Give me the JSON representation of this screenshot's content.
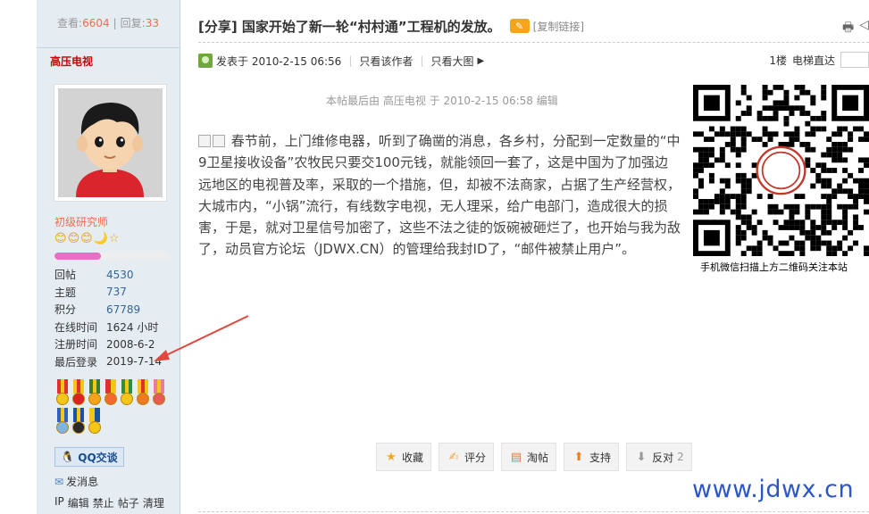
{
  "sidebar": {
    "views_label": "查看:",
    "views_count": "6604",
    "replies_label": "回复:",
    "replies_count": "33",
    "separator": "|",
    "username": "高压电视",
    "rank_title": "初级研究师",
    "rank_icons": [
      "😊",
      "😊",
      "😊",
      "🌙",
      "☆"
    ],
    "rank_progress": 0.4,
    "profile": [
      {
        "key": "回帖",
        "value": "4530"
      },
      {
        "key": "主题",
        "value": "737"
      },
      {
        "key": "积分",
        "value": "67789"
      },
      {
        "key": "在线时间",
        "value": "1624 小时"
      },
      {
        "key": "注册时间",
        "value": "2008-6-2"
      },
      {
        "key": "最后登录",
        "value": "2019-7-14"
      }
    ],
    "qq_label": "QQ交谈",
    "message_label": "发消息",
    "admin_links": [
      "IP",
      "编辑",
      "禁止",
      "帖子",
      "清理"
    ]
  },
  "post": {
    "title": "[分享] 国家开始了新一轮“村村通”工程机的发放。",
    "copy_link": "[复制链接]",
    "posted_label": "发表于 2010-2-15 06:56",
    "only_author": "只看该作者",
    "only_big_image": "只看大图",
    "floor": "1楼",
    "elevator_label": "电梯直达",
    "edit_note": "本帖最后由 高压电视 于 2010-2-15 06:58 编辑",
    "body": "春节前，上门维修电器，听到了确凿的消息，各乡村，分配到一定数量的“中9卫星接收设备”农牧民只要交100元钱，就能领回一套了，这是中国为了加强边远地区的电视普及率，采取的一个措施，但，却被不法商家，占据了生产经营权，大城市内，“小锅”流行，有线数字电视，无人理采，给广电部门，造成很大的损害，于是，就对卫星信号加密了，这些不法之徒的饭碗被砸烂了，也开始与我为敌了，动员官方论坛（JDWX.CN）的管理给我封ID了，“邮件被禁止用户”。",
    "qr_caption": "手机微信扫描上方二维码关注本站"
  },
  "actions": [
    {
      "name": "collect",
      "label": "收藏",
      "icon": "star-icon",
      "color": "#f5a623"
    },
    {
      "name": "rate",
      "label": "评分",
      "icon": "thumb-icon",
      "color": "#e8a84c"
    },
    {
      "name": "taotie",
      "label": "淘帖",
      "icon": "box-icon",
      "color": "#e07b39"
    },
    {
      "name": "support",
      "label": "支持",
      "icon": "up-arrow-icon",
      "color": "#f07c1e"
    },
    {
      "name": "oppose",
      "label": "反对",
      "icon": "down-arrow-icon",
      "color": "#999999",
      "count": "2"
    }
  ],
  "watermark": "www.jdwx.cn",
  "colors": {
    "sidebar_bg": "#e5edf2",
    "accent_red": "#cc0000",
    "link_blue": "#336699",
    "watermark_blue": "#2c57c9"
  }
}
